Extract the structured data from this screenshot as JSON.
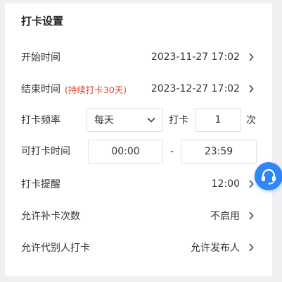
{
  "page": {
    "title": "打卡设置"
  },
  "rows": {
    "start_time": {
      "label": "开始时间",
      "value": "2023-11-27 17:02"
    },
    "end_time": {
      "label": "结束时间",
      "hint": "(持续打卡30天)",
      "value": "2023-12-27 17:02"
    },
    "frequency": {
      "label": "打卡频率",
      "select_value": "每天",
      "middle_label": "打卡",
      "count_value": "1",
      "unit": "次"
    },
    "window": {
      "label": "可打卡时间",
      "start": "00:00",
      "separator": "-",
      "end": "23:59"
    },
    "reminder": {
      "label": "打卡提醒",
      "value": "12:00"
    },
    "makeup": {
      "label": "允许补卡次数",
      "value": "不启用"
    },
    "proxy": {
      "label": "允许代别人打卡",
      "value": "允许发布人"
    }
  },
  "colors": {
    "accent_blue": "#2f86f6",
    "hint_red": "#e0442d",
    "background": "#f0f0f2"
  },
  "icons": {
    "chevron": "chevron-right-icon",
    "dropdown": "chevron-down-icon",
    "support": "headset-icon"
  }
}
